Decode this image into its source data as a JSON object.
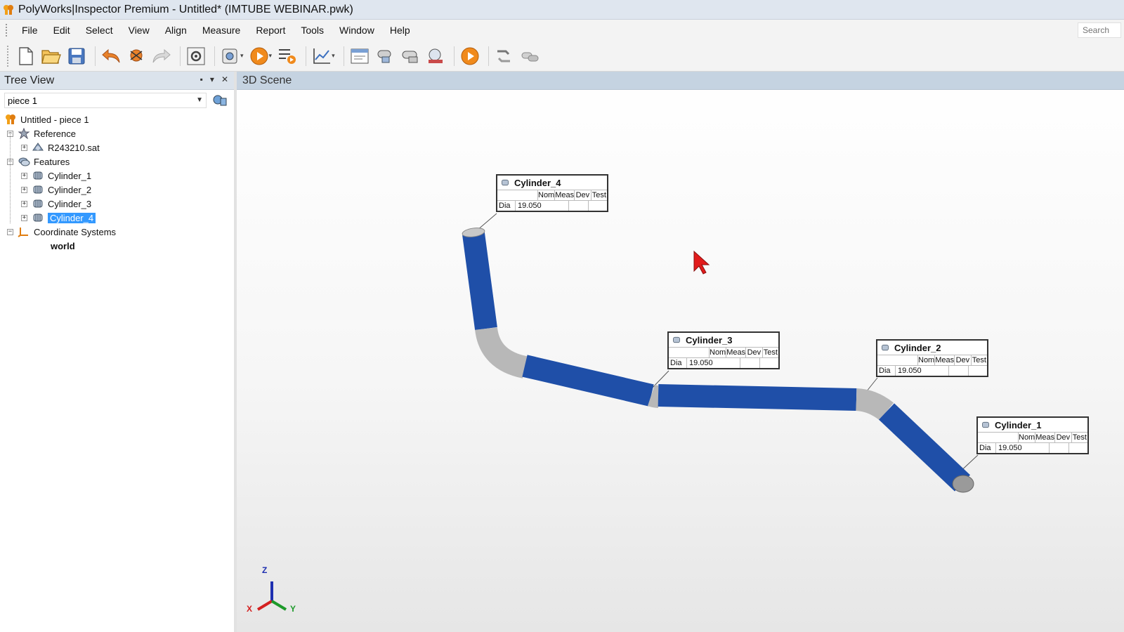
{
  "window": {
    "title": "PolyWorks|Inspector Premium - Untitled* (IMTUBE WEBINAR.pwk)"
  },
  "menu": {
    "items": [
      {
        "label": "File"
      },
      {
        "label": "Edit"
      },
      {
        "label": "Select"
      },
      {
        "label": "View"
      },
      {
        "label": "Align"
      },
      {
        "label": "Measure"
      },
      {
        "label": "Report"
      },
      {
        "label": "Tools"
      },
      {
        "label": "Window"
      },
      {
        "label": "Help"
      }
    ],
    "search_placeholder": "Search"
  },
  "toolbar": {
    "buttons": [
      "new-icon",
      "open-icon",
      "save-icon",
      "undo-icon",
      "clear-icon",
      "redo-icon",
      "settings-icon",
      "capture-icon",
      "play-icon",
      "sequence-icon",
      "chart-icon",
      "report-icon",
      "probe-icon",
      "probe2-icon",
      "device-icon",
      "play-orange-icon",
      "align-icon",
      "tube-icon"
    ]
  },
  "tree_panel": {
    "title": "Tree View",
    "piece_selector": "piece 1",
    "root": "Untitled - piece 1",
    "reference": {
      "label": "Reference",
      "children": [
        "R243210.sat"
      ]
    },
    "features": {
      "label": "Features",
      "children": [
        "Cylinder_1",
        "Cylinder_2",
        "Cylinder_3",
        "Cylinder_4"
      ],
      "selected": "Cylinder_4"
    },
    "coordinate_systems": {
      "label": "Coordinate Systems",
      "children": [
        "world"
      ]
    }
  },
  "scene": {
    "title": "3D Scene",
    "tube_color": "#1f4fa8",
    "bend_color": "#b8b8b8",
    "callouts": [
      {
        "name": "Cylinder_4",
        "cols": [
          "Nom",
          "Meas",
          "Dev",
          "Test"
        ],
        "row_label": "Dia",
        "nom": "19.050"
      },
      {
        "name": "Cylinder_3",
        "cols": [
          "Nom",
          "Meas",
          "Dev",
          "Test"
        ],
        "row_label": "Dia",
        "nom": "19.050"
      },
      {
        "name": "Cylinder_2",
        "cols": [
          "Nom",
          "Meas",
          "Dev",
          "Test"
        ],
        "row_label": "Dia",
        "nom": "19.050"
      },
      {
        "name": "Cylinder_1",
        "cols": [
          "Nom",
          "Meas",
          "Dev",
          "Test"
        ],
        "row_label": "Dia",
        "nom": "19.050"
      }
    ],
    "axes": {
      "z": "Z",
      "x": "X",
      "y": "Y"
    }
  }
}
